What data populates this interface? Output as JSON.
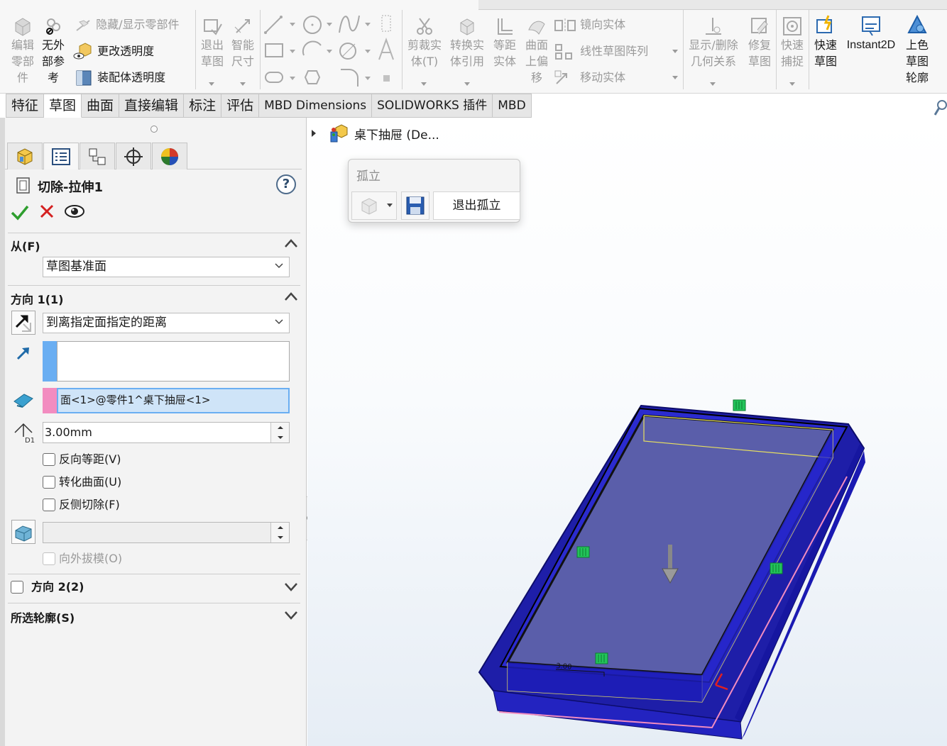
{
  "ribbon": {
    "edit_part": [
      "编辑",
      "零部",
      "件"
    ],
    "no_ext_ref": [
      "无外",
      "部参",
      "考"
    ],
    "hide_show": "隐藏/显示零部件",
    "change_transparency": "更改透明度",
    "assembly_transparency": "装配体透明度",
    "exit_sketch": [
      "退出",
      "草图"
    ],
    "smart_dim": [
      "智能",
      "尺寸"
    ],
    "trim": [
      "剪裁实",
      "体(T)"
    ],
    "convert": [
      "转换实",
      "体引用"
    ],
    "offset": [
      "等距",
      "实体"
    ],
    "surface_offset": [
      "曲面",
      "上偏",
      "移"
    ],
    "mirror": "镜向实体",
    "linear_pattern": "线性草图阵列",
    "move_entities": "移动实体",
    "display_relations": [
      "显示/删除",
      "几何关系"
    ],
    "repair_sketch": [
      "修复",
      "草图"
    ],
    "quick_snaps": [
      "快速",
      "捕捉"
    ],
    "rapid_sketch": [
      "快速",
      "草图"
    ],
    "instant2d": "Instant2D",
    "shaded_contours": [
      "上色",
      "草图",
      "轮廓"
    ]
  },
  "tabs": [
    "特征",
    "草图",
    "曲面",
    "直接编辑",
    "标注",
    "评估",
    "MBD Dimensions",
    "SOLIDWORKS 插件",
    "MBD"
  ],
  "active_tab": "草图",
  "property_manager": {
    "feature_title": "切除-拉伸1",
    "from_section": {
      "header": "从(F)",
      "value": "草图基准面"
    },
    "direction1": {
      "header": "方向 1(1)",
      "end_condition": "到离指定面指定的距离",
      "face_ref": "面<1>@零件1^桌下抽屉<1>",
      "distance": "3.00mm",
      "reverse_offset": "反向等距(V)",
      "translate_surface": "转化曲面(U)",
      "flip_side": "反侧切除(F)",
      "draft_outward": "向外拔模(O)"
    },
    "direction2": {
      "header": "方向 2(2)"
    },
    "selected_contours": {
      "header": "所选轮廓(S)"
    }
  },
  "viewport": {
    "tree_item": "桌下抽屉 (De...",
    "isolate_title": "孤立",
    "exit_isolate": "退出孤立",
    "dim_label": "3.00"
  },
  "colors": {
    "model_blue": "#1f1fbf",
    "model_face": "#5a5eaa",
    "handle_green": "#22c45a",
    "accept_green": "#2e9e2e",
    "cancel_red": "#d42020",
    "face_ref_pink": "#f28cc0",
    "select_blue": "#6aaef2"
  }
}
